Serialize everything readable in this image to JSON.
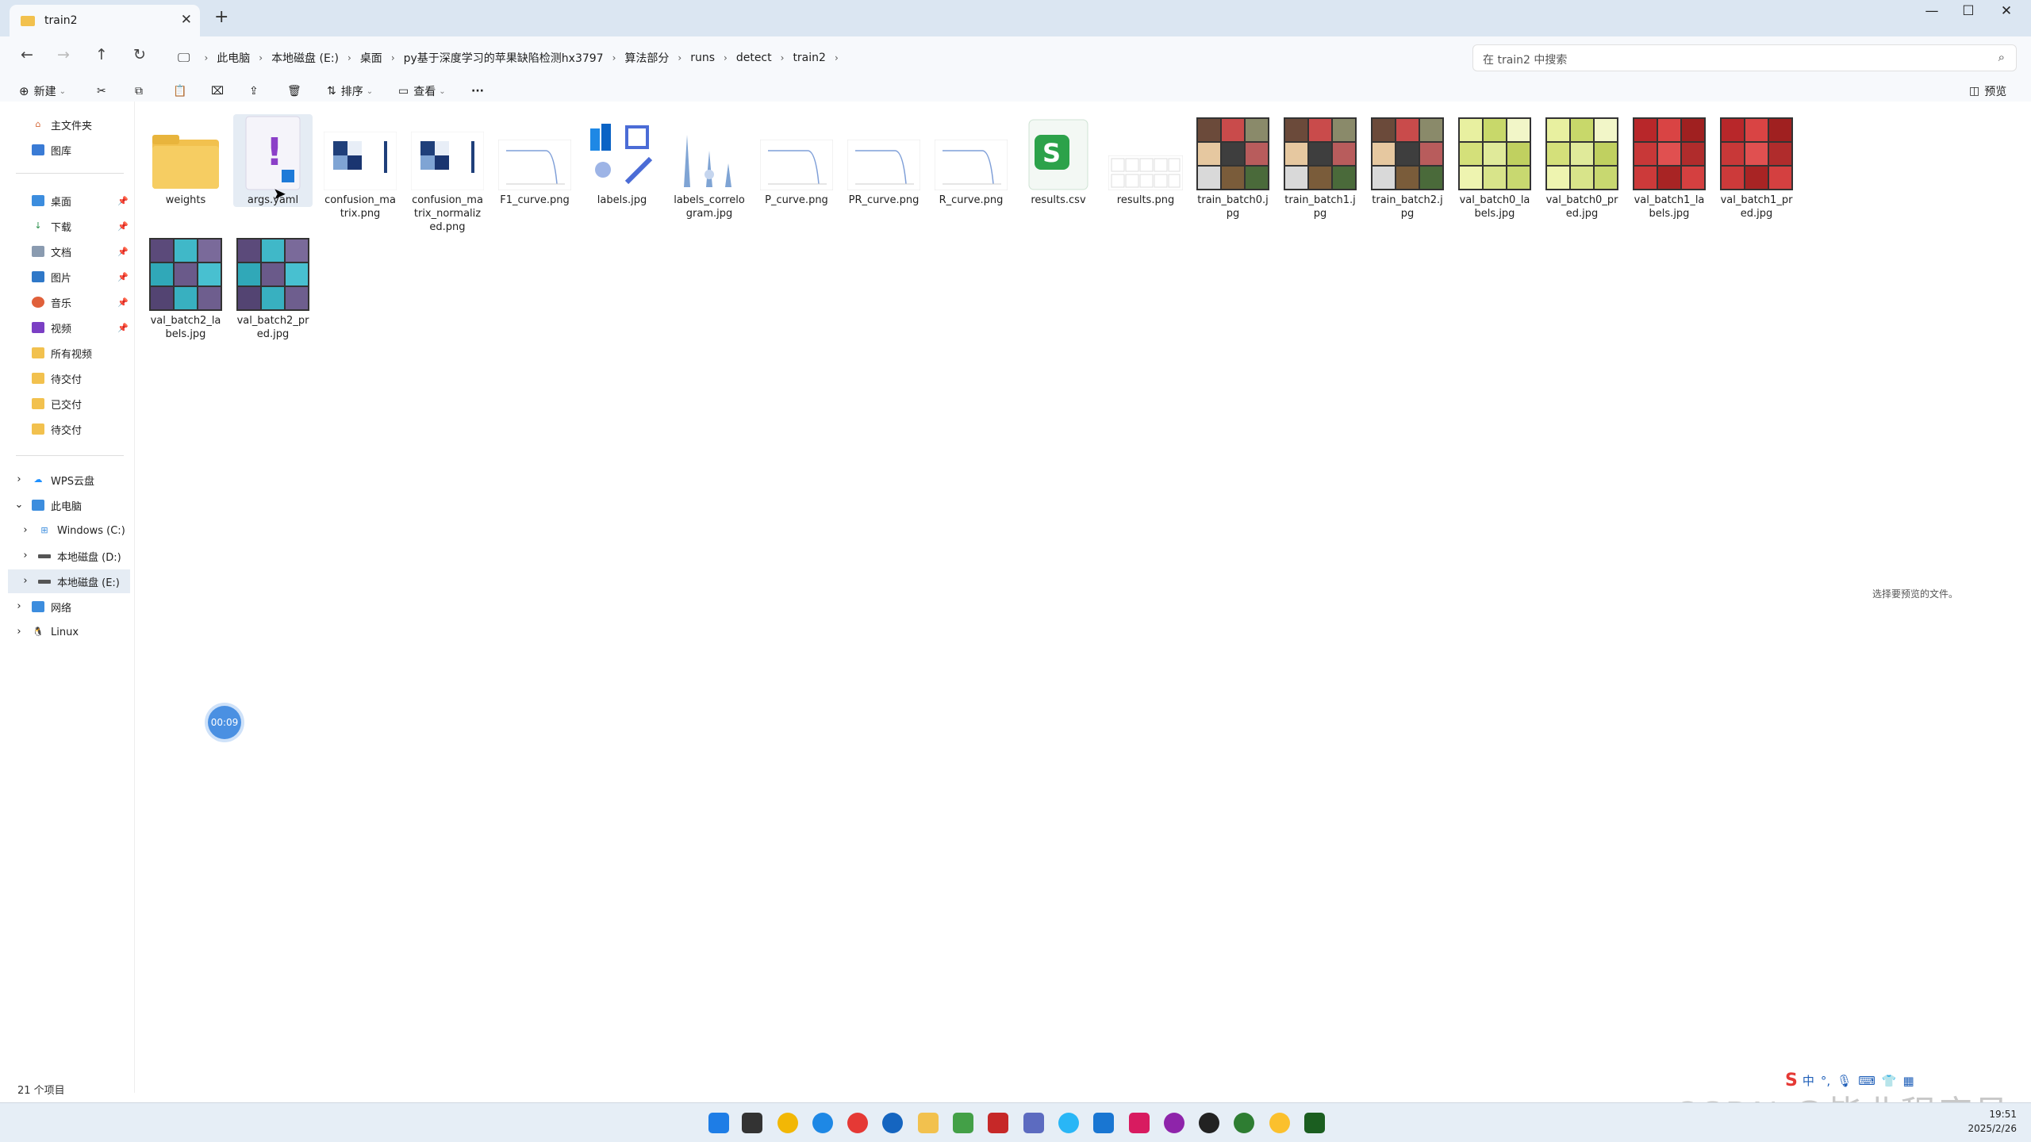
{
  "window": {
    "tab_title": "train2",
    "new_tab": "+",
    "minimize": "—",
    "maximize": "☐",
    "close": "✕"
  },
  "address": {
    "crumbs": [
      "此电脑",
      "本地磁盘 (E:)",
      "桌面",
      "py基于深度学习的苹果缺陷检测hx3797",
      "算法部分",
      "runs",
      "detect",
      "train2"
    ],
    "search_placeholder": "在 train2 中搜索"
  },
  "toolbar": {
    "new_label": "新建",
    "sort_label": "排序",
    "view_label": "查看",
    "more_label": "···",
    "preview_label": "预览"
  },
  "sidebar": {
    "quick": [
      {
        "label": "主文件夹",
        "icon": "home-icon"
      },
      {
        "label": "图库",
        "icon": "gallery-icon"
      }
    ],
    "pinned": [
      {
        "label": "桌面",
        "icon": "desktop-icon"
      },
      {
        "label": "下载",
        "icon": "download-icon"
      },
      {
        "label": "文档",
        "icon": "document-icon"
      },
      {
        "label": "图片",
        "icon": "pictures-icon"
      },
      {
        "label": "音乐",
        "icon": "music-icon"
      },
      {
        "label": "视频",
        "icon": "video-icon"
      }
    ],
    "folders": [
      "所有视频",
      "待交付",
      "已交付",
      "待交付"
    ],
    "tree": [
      {
        "label": "WPS云盘",
        "expander": "›"
      },
      {
        "label": "此电脑",
        "expander": "⌄"
      },
      {
        "label": "Windows (C:)",
        "expander": "›"
      },
      {
        "label": "本地磁盘 (D:)",
        "expander": "›"
      },
      {
        "label": "本地磁盘 (E:)",
        "expander": "›"
      },
      {
        "label": "网络",
        "expander": "›"
      },
      {
        "label": "Linux",
        "expander": "›"
      }
    ]
  },
  "files": [
    {
      "name": "weights",
      "kind": "folder"
    },
    {
      "name": "args.yaml",
      "kind": "yaml"
    },
    {
      "name": "confusion_matrix.png",
      "kind": "matrix"
    },
    {
      "name": "confusion_matrix_normalized.png",
      "kind": "matrix"
    },
    {
      "name": "F1_curve.png",
      "kind": "curve"
    },
    {
      "name": "labels.jpg",
      "kind": "labels"
    },
    {
      "name": "labels_correlogram.jpg",
      "kind": "correlogram"
    },
    {
      "name": "P_curve.png",
      "kind": "curve"
    },
    {
      "name": "PR_curve.png",
      "kind": "curve"
    },
    {
      "name": "R_curve.png",
      "kind": "curve"
    },
    {
      "name": "results.csv",
      "kind": "csv"
    },
    {
      "name": "results.png",
      "kind": "results"
    },
    {
      "name": "train_batch0.jpg",
      "kind": "batch"
    },
    {
      "name": "train_batch1.jpg",
      "kind": "batch"
    },
    {
      "name": "train_batch2.jpg",
      "kind": "batch"
    },
    {
      "name": "val_batch0_labels.jpg",
      "kind": "valgreen"
    },
    {
      "name": "val_batch0_pred.jpg",
      "kind": "valgreen"
    },
    {
      "name": "val_batch1_labels.jpg",
      "kind": "valred"
    },
    {
      "name": "val_batch1_pred.jpg",
      "kind": "valred"
    },
    {
      "name": "val_batch2_labels.jpg",
      "kind": "valpurple"
    },
    {
      "name": "val_batch2_pred.jpg",
      "kind": "valpurple"
    }
  ],
  "preview_hint": "选择要预览的文件。",
  "status_count": "21 个项目",
  "recorder_time": "00:09",
  "tray": {
    "time": "19:51",
    "date": "2025/2/26",
    "ime": "中"
  },
  "watermark": "CSDN @毕业程序员",
  "colors": {
    "titlebar": "#dbe6f2",
    "selection": "#e5ecf4",
    "accent": "#0067c0"
  }
}
